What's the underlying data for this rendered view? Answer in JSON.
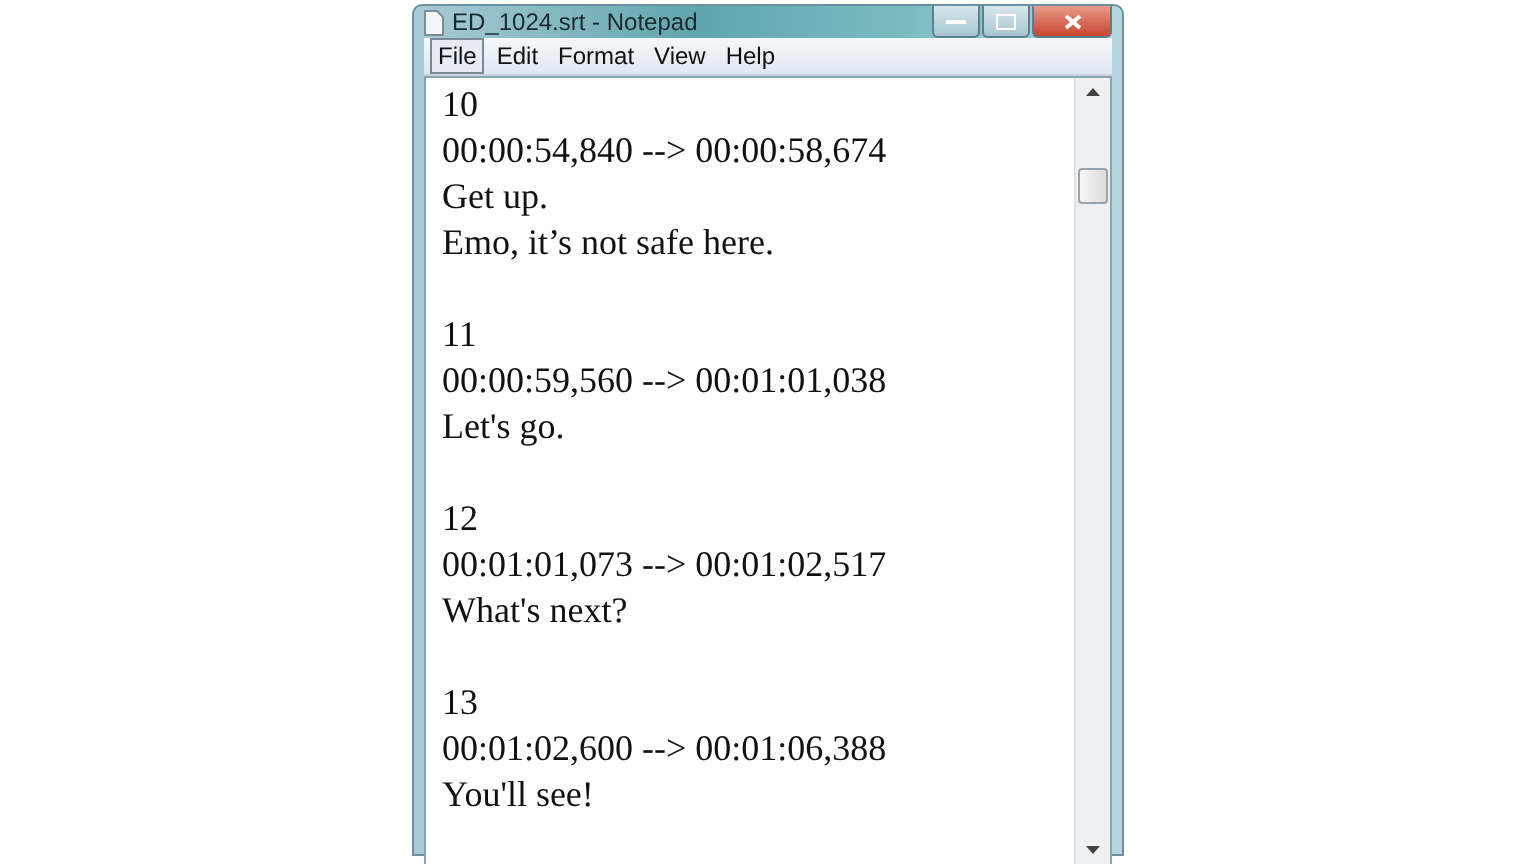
{
  "window": {
    "title": "ED_1024.srt - Notepad"
  },
  "menu": [
    {
      "label": "File",
      "selected": true
    },
    {
      "label": "Edit",
      "selected": false
    },
    {
      "label": "Format",
      "selected": false
    },
    {
      "label": "View",
      "selected": false
    },
    {
      "label": "Help",
      "selected": false
    }
  ],
  "document": {
    "entries": [
      {
        "number": "10",
        "timing": "00:00:54,840 --> 00:00:58,674",
        "lines": [
          "Get up.",
          "Emo, it’s not safe here."
        ]
      },
      {
        "number": "11",
        "timing": "00:00:59,560 --> 00:01:01,038",
        "lines": [
          "Let's go."
        ]
      },
      {
        "number": "12",
        "timing": "00:01:01,073 --> 00:01:02,517",
        "lines": [
          "What's next?"
        ]
      },
      {
        "number": "13",
        "timing": "00:01:02,600 --> 00:01:06,388",
        "lines": [
          "You'll see!"
        ]
      }
    ]
  }
}
